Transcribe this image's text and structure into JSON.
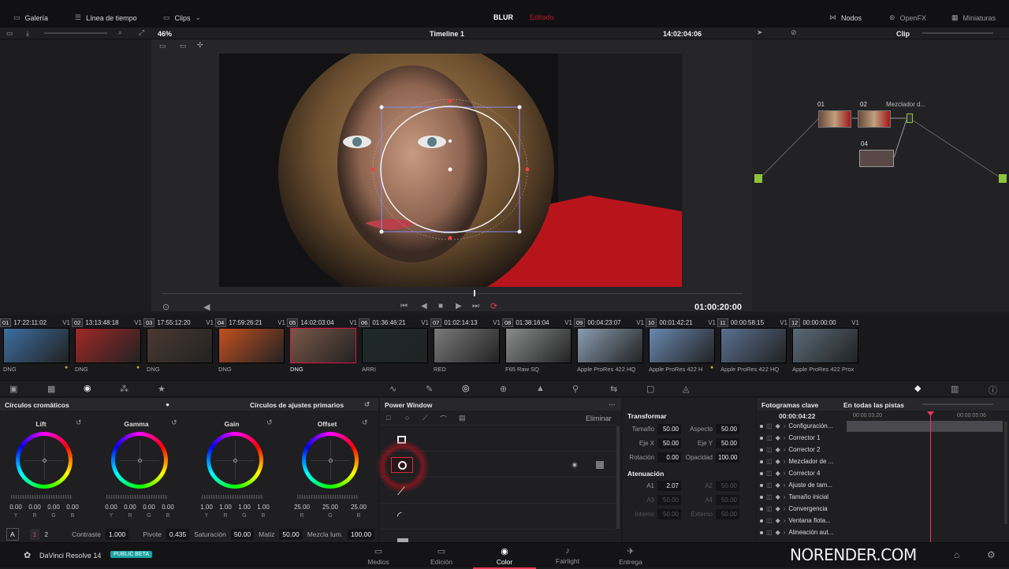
{
  "topbar": {
    "gallery": "Galería",
    "timeline": "Línea de tiempo",
    "clips": "Clips",
    "project": "BLUR",
    "edited": "Editado",
    "nodes": "Nodos",
    "openfx": "OpenFX",
    "thumbs": "Miniaturas"
  },
  "subbar": {
    "zoom": "46%",
    "timeline_name": "Timeline 1",
    "timecode": "14:02:04:06",
    "mode": "Clip"
  },
  "viewer": {
    "playhead_tc": "01:00:20:00"
  },
  "node_graph": {
    "labels": [
      "01",
      "02",
      "04"
    ],
    "mixer_label": "Mezclador d..."
  },
  "clips": [
    {
      "num": "01",
      "tc": "17:22:11:02",
      "track": "V1",
      "codec": "DNG",
      "color": "#3d6ea0",
      "badge": true
    },
    {
      "num": "02",
      "tc": "13:13:48:18",
      "track": "V1",
      "codec": "DNG",
      "color": "#a02828",
      "badge": true
    },
    {
      "num": "03",
      "tc": "17:55:12:20",
      "track": "V1",
      "codec": "DNG",
      "color": "#4a3a30",
      "badge": false
    },
    {
      "num": "04",
      "tc": "17:59:26:21",
      "track": "V1",
      "codec": "DNG",
      "color": "#c25020",
      "badge": false
    },
    {
      "num": "05",
      "tc": "14:02:03:04",
      "track": "V1",
      "codec": "DNG",
      "color": "#7a5848",
      "badge": false,
      "selected": true
    },
    {
      "num": "06",
      "tc": "01:36:46:21",
      "track": "V1",
      "codec": "ARRI",
      "color": "#1e2a2a",
      "badge": false
    },
    {
      "num": "07",
      "tc": "01:02:14:13",
      "track": "V1",
      "codec": "RED",
      "color": "#7a7a7a",
      "badge": false
    },
    {
      "num": "08",
      "tc": "01:38:16:04",
      "track": "V1",
      "codec": "F65 Raw SQ",
      "color": "#8a8c8c",
      "badge": false
    },
    {
      "num": "09",
      "tc": "00:04:23:07",
      "track": "V1",
      "codec": "Apple ProRes 422 HQ",
      "color": "#8a9cb0",
      "badge": false
    },
    {
      "num": "10",
      "tc": "00:01:42:21",
      "track": "V1",
      "codec": "Apple ProRes 422 H",
      "color": "#6a88b0",
      "badge": true
    },
    {
      "num": "11",
      "tc": "00:00:58:15",
      "track": "V1",
      "codec": "Apple ProRes 422 HQ",
      "color": "#5a7090",
      "badge": false
    },
    {
      "num": "12",
      "tc": "00:00:00:00",
      "track": "V1",
      "codec": "Apple ProRes 422 Prox",
      "color": "#5a6a78",
      "badge": false
    }
  ],
  "wheels": {
    "title": "Círculos cromáticos",
    "mode": "Círculos de ajustes primarios",
    "items": [
      {
        "label": "Lift",
        "vals": [
          "0.00",
          "0.00",
          "0.00",
          "0.00"
        ],
        "chs": [
          "Y",
          "R",
          "G",
          "B"
        ]
      },
      {
        "label": "Gamma",
        "vals": [
          "0.00",
          "0.00",
          "0.00",
          "0.00"
        ],
        "chs": [
          "Y",
          "R",
          "G",
          "B"
        ]
      },
      {
        "label": "Gain",
        "vals": [
          "1.00",
          "1.00",
          "1.00",
          "1.00"
        ],
        "chs": [
          "Y",
          "R",
          "G",
          "B"
        ]
      },
      {
        "label": "Offset",
        "vals": [
          "25.00",
          "25.00",
          "25.00"
        ],
        "chs": [
          "R",
          "G",
          "B"
        ]
      }
    ],
    "bottom": {
      "a": "A",
      "p1": "1",
      "p2": "2",
      "contrast_label": "Contraste",
      "contrast": "1.000",
      "pivot_label": "Pivote",
      "pivot": "0.435",
      "sat_label": "Saturación",
      "sat": "50.00",
      "hue_label": "Matiz",
      "hue": "50.00",
      "lum_label": "Mezcla lum.",
      "lum": "100.00"
    }
  },
  "power_window": {
    "title": "Power Window",
    "delete": "Eliminar"
  },
  "transform": {
    "title": "Transformar",
    "size_label": "Tamaño",
    "size": "50.00",
    "aspect_label": "Aspecto",
    "aspect": "50.00",
    "x_label": "Eje X",
    "x": "50.00",
    "y_label": "Eje Y",
    "y": "50.00",
    "rot_label": "Rotación",
    "rot": "0.00",
    "opac_label": "Opacidad",
    "opac": "100.00",
    "soft_title": "Atenuación",
    "a1_label": "A1",
    "a1": "2.07",
    "a2_label": "A2",
    "a2": "50.00",
    "a3_label": "A3",
    "a3": "50.00",
    "a4_label": "A4",
    "a4": "50.00",
    "in_label": "Interno",
    "in": "50.00",
    "out_label": "Externo",
    "out": "50.00"
  },
  "keyframes": {
    "title": "Fotogramas clave",
    "scope": "En todas las pistas",
    "current": "00:00:04:22",
    "t1": "00:00:03:20",
    "t2": "00:00:05:06",
    "rows": [
      "Configuración...",
      "Corrector 1",
      "Corrector 2",
      "Mezclador de ...",
      "Corrector 4",
      "Ajuste de tam...",
      "Tamaño inicial",
      "Convergencia",
      "Ventana flota...",
      "Alineación aut..."
    ]
  },
  "footer": {
    "app": "DaVinci Resolve 14",
    "beta": "PUBLIC BETA",
    "pages": [
      "Medios",
      "Edición",
      "Color",
      "Fairlight",
      "Entrega"
    ],
    "active_page": "Color",
    "watermark": "NORENDER.COM"
  },
  "colors": {
    "accent": "#e63956",
    "beta_badge": "#1aa3a3"
  }
}
